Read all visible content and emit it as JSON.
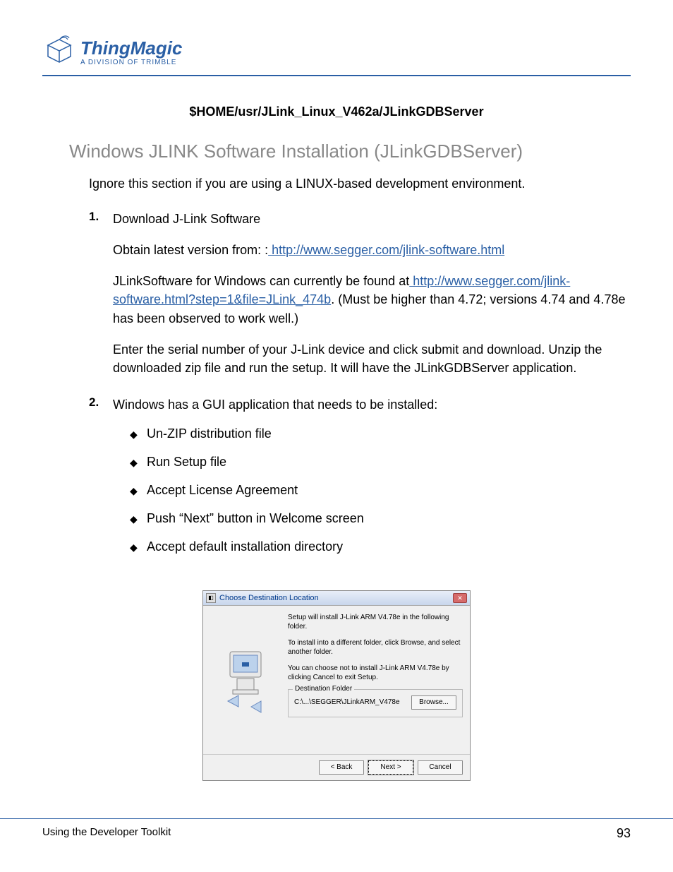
{
  "header": {
    "logo_main": "ThingMagic",
    "logo_sub": "A DIVISION OF TRIMBLE"
  },
  "code_path": "$HOME/usr/JLink_Linux_V462a/JLinkGDBServer",
  "section_title": "Windows JLINK Software Installation (JLinkGDBServer)",
  "intro": "Ignore this section if you are using a LINUX-based development environment.",
  "steps": [
    {
      "num": "1.",
      "title": "Download J-Link Software",
      "p1_pre": "Obtain latest version from: :",
      "p1_link": " http://www.segger.com/jlink-software.html",
      "p2_pre": "JLinkSoftware for Windows can currently be found at",
      "p2_link": " http://www.segger.com/jlink-software.html?step=1&file=JLink_474b",
      "p2_post": ". (Must be higher than 4.72; versions 4.74 and 4.78e has been observed to work well.)",
      "p3": "Enter the serial number of your J-Link device and click submit and download. Unzip the downloaded zip file and run the setup. It will have the JLinkGDBServer application."
    },
    {
      "num": "2.",
      "title": "Windows has a GUI application that needs to be installed:",
      "bullets": [
        "Un-ZIP distribution file",
        "Run Setup file",
        "Accept License Agreement",
        "Push “Next” button in Welcome screen",
        "Accept default installation directory"
      ]
    }
  ],
  "dialog": {
    "title": "Choose Destination Location",
    "line1": "Setup will install J-Link ARM V4.78e in the following folder.",
    "line2": "To install into a different folder, click Browse, and select another folder.",
    "line3": "You can choose not to install J-Link ARM V4.78e by clicking Cancel to exit Setup.",
    "group_label": "Destination Folder",
    "path": "C:\\...\\SEGGER\\JLinkARM_V478e",
    "browse": "Browse...",
    "back": "< Back",
    "next": "Next >",
    "cancel": "Cancel"
  },
  "footer": {
    "left": "Using the Developer Toolkit",
    "page": "93"
  }
}
